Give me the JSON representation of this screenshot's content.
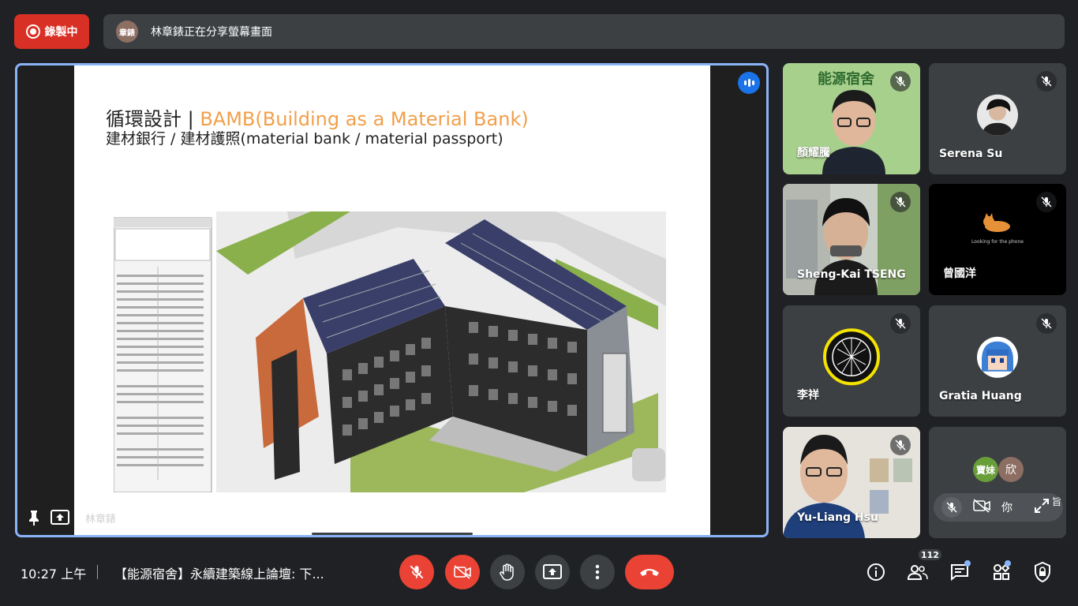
{
  "top_bar": {
    "recording_label": "錄製中",
    "presenter_initials": "章錶",
    "share_message": "林章錶正在分享螢幕畫面"
  },
  "presentation": {
    "slide_title_prefix": "循環設計 | ",
    "slide_title_highlight": "BAMB(Building as a Material Bank)",
    "slide_subtitle": "建材銀行 / 建材護照(material bank / material passport)",
    "presenter_name": "林章錶"
  },
  "participants": [
    {
      "name": "顏耀騰",
      "muted": true,
      "tile_label_logo": "能源宿舍"
    },
    {
      "name": "Serena Su",
      "muted": true
    },
    {
      "name": "Sheng-Kai TSENG",
      "muted": true
    },
    {
      "name": "曾國洋",
      "muted": true,
      "caption": "Looking for the phone"
    },
    {
      "name": "李祥",
      "muted": true
    },
    {
      "name": "Gratia Huang",
      "muted": true
    },
    {
      "name": "Yu-Liang Hsu",
      "muted": true
    }
  ],
  "self_tile": {
    "avatar_1": "寶妹",
    "avatar_2": "欣",
    "self_label": "你",
    "extra_label": "旨"
  },
  "bottom_bar": {
    "time": "10:27 上午",
    "meeting_title": "【能源宿舍】永續建築線上論壇: 下...",
    "people_count": "112"
  },
  "colors": {
    "accent_blue": "#8ab4f8",
    "danger_red": "#ea4335",
    "slide_orange": "#f0a04b",
    "bar_gray": "#3c4043"
  }
}
